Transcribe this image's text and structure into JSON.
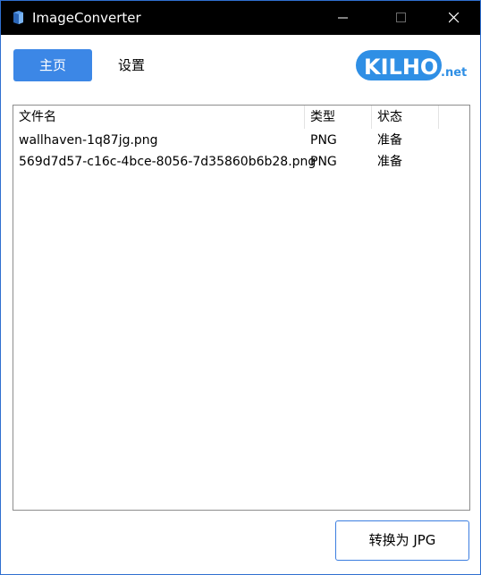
{
  "window": {
    "title": "ImageConverter",
    "accent": "#3c87e6"
  },
  "toolbar": {
    "home_label": "主页",
    "settings_label": "设置",
    "logo_text": "KILHO.net"
  },
  "file_list": {
    "columns": [
      "文件名",
      "类型",
      "状态"
    ],
    "rows": [
      {
        "name": "wallhaven-1q87jg.png",
        "type": "PNG",
        "status": "准备"
      },
      {
        "name": "569d7d57-c16c-4bce-8056-7d35860b6b28.png",
        "type": "PNG",
        "status": "准备"
      }
    ]
  },
  "actions": {
    "convert_label": "转换为 JPG"
  }
}
